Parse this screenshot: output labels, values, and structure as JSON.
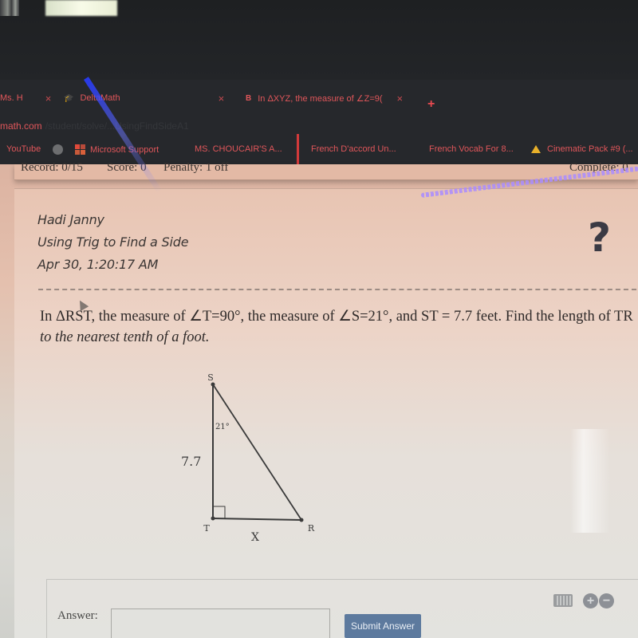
{
  "browser": {
    "tabs": [
      {
        "label": "Ms. H",
        "icon": "tab-favicon",
        "close": "×"
      },
      {
        "label": "DeltaMath",
        "icon": "graduation-cap-icon",
        "close": "×"
      },
      {
        "label": "In ΔXYZ, the measure of ∠Z=9(",
        "icon": "brainly-icon",
        "close": "×"
      }
    ],
    "new_tab": "+",
    "url": {
      "domain": "math.com",
      "path": "/student/solve/...UsingFindSideA1"
    },
    "bookmarks": [
      {
        "label": "YouTube",
        "icon": "youtube-icon"
      },
      {
        "label": "",
        "icon": "globe-icon"
      },
      {
        "label": "Microsoft Support",
        "icon": "microsoft-icon"
      },
      {
        "label": "MS. CHOUCAIR'S A...",
        "icon": "bookmark-icon"
      },
      {
        "label": "French D'accord Un...",
        "icon": "bookmark-icon"
      },
      {
        "label": "French Vocab For 8...",
        "icon": "bookmark-icon"
      },
      {
        "label": "Cinematic Pack #9 (...",
        "icon": "google-drive-icon"
      }
    ]
  },
  "status": {
    "record": "Record: 0/15",
    "score": "Score: 0",
    "penalty": "Penalty: 1 off",
    "complete": "Complete: 0"
  },
  "header": {
    "student": "Hadi Janny",
    "assignment": "Using Trig to Find a Side",
    "timestamp": "Apr 30, 1:20:17 AM",
    "help": "?"
  },
  "question": {
    "part1": "In ΔRST, the measure of ∠T=90°, the measure of ∠S=21°, and ST = 7.7 feet. Find the length of TR ",
    "part2": "to the nearest tenth of a foot."
  },
  "diagram": {
    "vertices": {
      "S": "S",
      "T": "T",
      "R": "R"
    },
    "angle_label": "21°",
    "side_label": "7.7",
    "unknown_label": "X"
  },
  "answer": {
    "label": "Answer:",
    "value": "",
    "placeholder": "",
    "submit": "Submit Answer",
    "zoom_in": "+",
    "zoom_out": "−"
  }
}
